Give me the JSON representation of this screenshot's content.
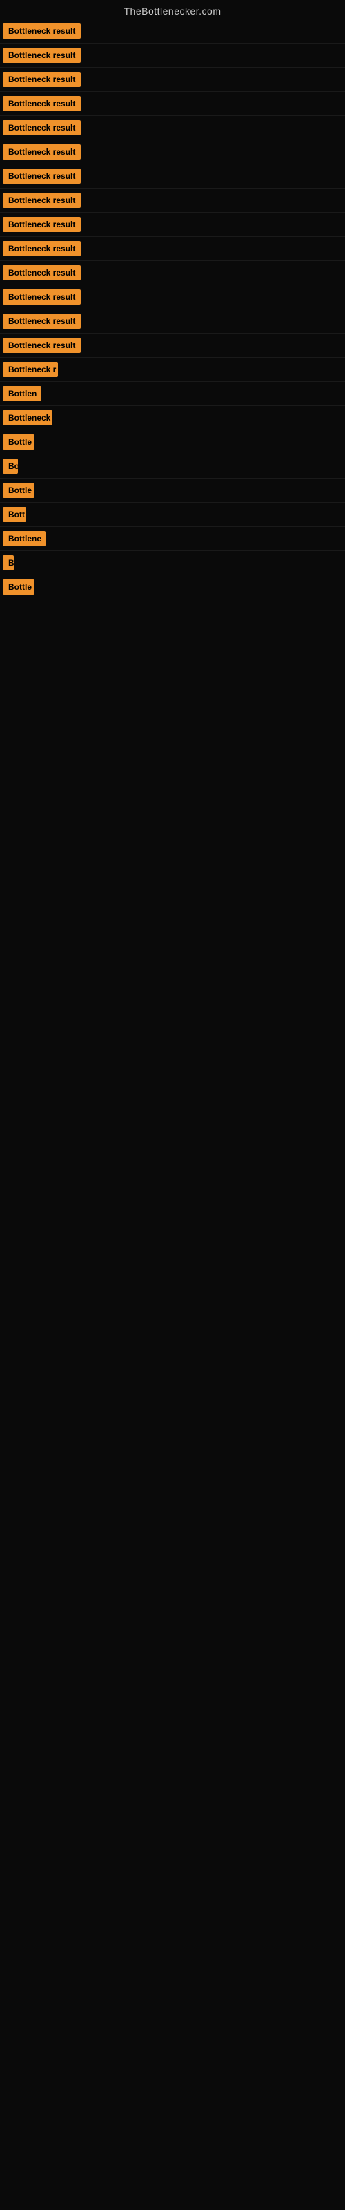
{
  "site": {
    "title": "TheBottlenecker.com"
  },
  "rows": [
    {
      "label": "Bottleneck result",
      "width": 130
    },
    {
      "label": "Bottleneck result",
      "width": 130
    },
    {
      "label": "Bottleneck result",
      "width": 130
    },
    {
      "label": "Bottleneck result",
      "width": 130
    },
    {
      "label": "Bottleneck result",
      "width": 130
    },
    {
      "label": "Bottleneck result",
      "width": 130
    },
    {
      "label": "Bottleneck result",
      "width": 130
    },
    {
      "label": "Bottleneck result",
      "width": 130
    },
    {
      "label": "Bottleneck result",
      "width": 130
    },
    {
      "label": "Bottleneck result",
      "width": 130
    },
    {
      "label": "Bottleneck result",
      "width": 130
    },
    {
      "label": "Bottleneck result",
      "width": 118
    },
    {
      "label": "Bottleneck result",
      "width": 118
    },
    {
      "label": "Bottleneck result",
      "width": 116
    },
    {
      "label": "Bottleneck r",
      "width": 80
    },
    {
      "label": "Bottlen",
      "width": 56
    },
    {
      "label": "Bottleneck",
      "width": 72
    },
    {
      "label": "Bottle",
      "width": 46
    },
    {
      "label": "Bo",
      "width": 22
    },
    {
      "label": "Bottle",
      "width": 46
    },
    {
      "label": "Bott",
      "width": 34
    },
    {
      "label": "Bottlene",
      "width": 62
    },
    {
      "label": "B",
      "width": 12
    },
    {
      "label": "Bottle",
      "width": 46
    }
  ],
  "colors": {
    "badge_bg": "#f0922b",
    "site_title": "#cccccc",
    "body_bg": "#0a0a0a"
  }
}
